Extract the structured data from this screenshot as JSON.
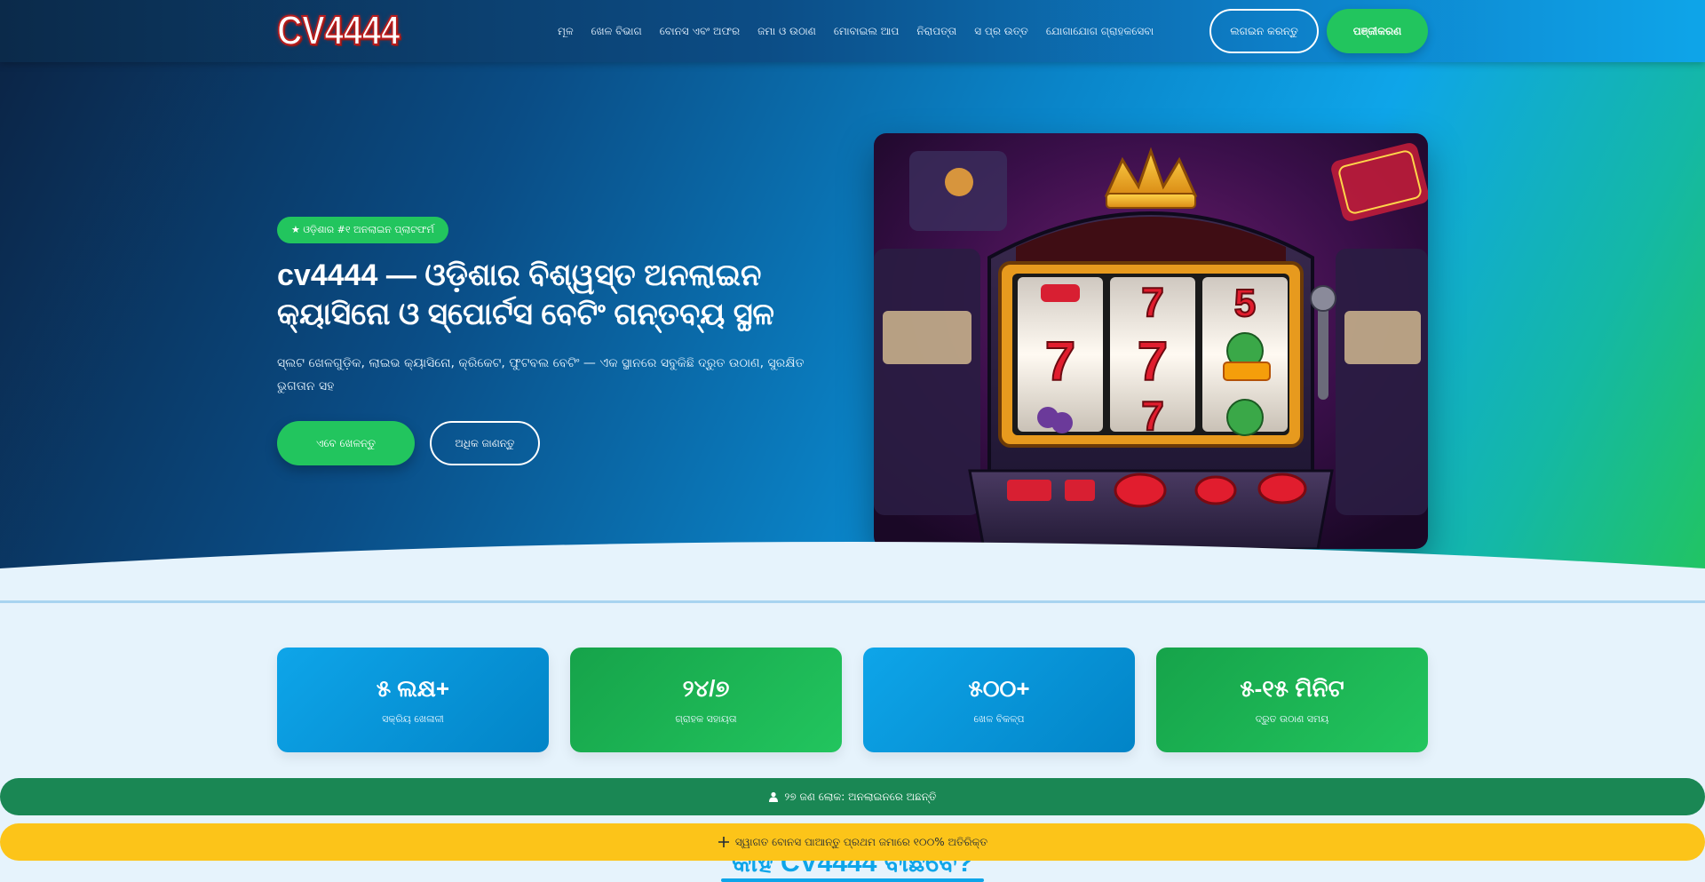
{
  "header": {
    "logo": "CV4444",
    "nav": [
      "ମୂଳ",
      "ଖେଳ ବିଭାଗ",
      "ବୋନସ ଏବଂ ଅଫର",
      "ଜମା ଓ ଉଠାଣ",
      "ମୋବାଇଲ ଆପ",
      "ନିରାପତ୍ତା",
      "ସ ପ୍ର ଉତ୍ତ",
      "ଯୋଗାଯୋଗ ଗ୍ରାହକସେବା"
    ],
    "login_label": "ଲଗଇନ କରନ୍ତୁ",
    "register_label": "ପଞ୍ଜୀକରଣ"
  },
  "hero": {
    "badge": "★ ଓଡ଼ିଶାର #୧ ଅନଲାଇନ ପ୍ଲାଟଫର୍ମ",
    "title": "cv4444 — ଓଡ଼ିଶାର ବିଶ୍ୱସ୍ତ ଅନଲାଇନ କ୍ୟାସିନୋ ଓ ସ୍ପୋର୍ଟସ ବେଟିଂ ଗନ୍ତବ୍ୟ ସ୍ଥଳ",
    "subtitle": "ସ୍ଲଟ ଖେଳଗୁଡ଼ିକ, ଲାଇଭ କ୍ୟାସିନୋ, କ୍ରିକେଟ, ଫୁଟବଲ ବେଟିଂ — ଏକ ସ୍ଥାନରେ ସବୁକିଛି ଦ୍ରୁତ ଉଠାଣ, ସୁରକ୍ଷିତ ଭୁଗତାନ ସହ",
    "primary_cta": "ଏବେ ଖେଳନ୍ତୁ",
    "secondary_cta": "ଅଧିକ ଜାଣନ୍ତୁ"
  },
  "stats": [
    {
      "value": "୫ ଲକ୍ଷ+",
      "label": "ସକ୍ରିୟ ଖେଳାଳୀ"
    },
    {
      "value": "୨୪/୭",
      "label": "ଗ୍ରାହକ ସହାୟତା"
    },
    {
      "value": "୫୦୦+",
      "label": "ଖେଳ ବିକଳ୍ପ"
    },
    {
      "value": "୫-୧୫ ମିନିଟ",
      "label": "ଦ୍ରୁତ ଉଠାଣ ସମୟ"
    }
  ],
  "section": {
    "heading": "କାହିଁ CV4444 ବାଛିବେ?"
  },
  "sticky": {
    "online_text": "୨୭ ଜଣ ଲୋକ: ଅନଲାଇନରେ ଅଛନ୍ତି",
    "promo_text": "ସ୍ୱାଗତ ବୋନସ ପାଆନ୍ତୁ ପ୍ରଥମ ଜମାରେ ୧୦୦% ଅତିରିକ୍ତ"
  },
  "colors": {
    "accent_green": "#22c55e",
    "accent_blue": "#0ea5e9",
    "promo_yellow": "#fcc419",
    "online_green": "#1a8754"
  },
  "icons": [
    "user-icon",
    "gift-icon"
  ]
}
